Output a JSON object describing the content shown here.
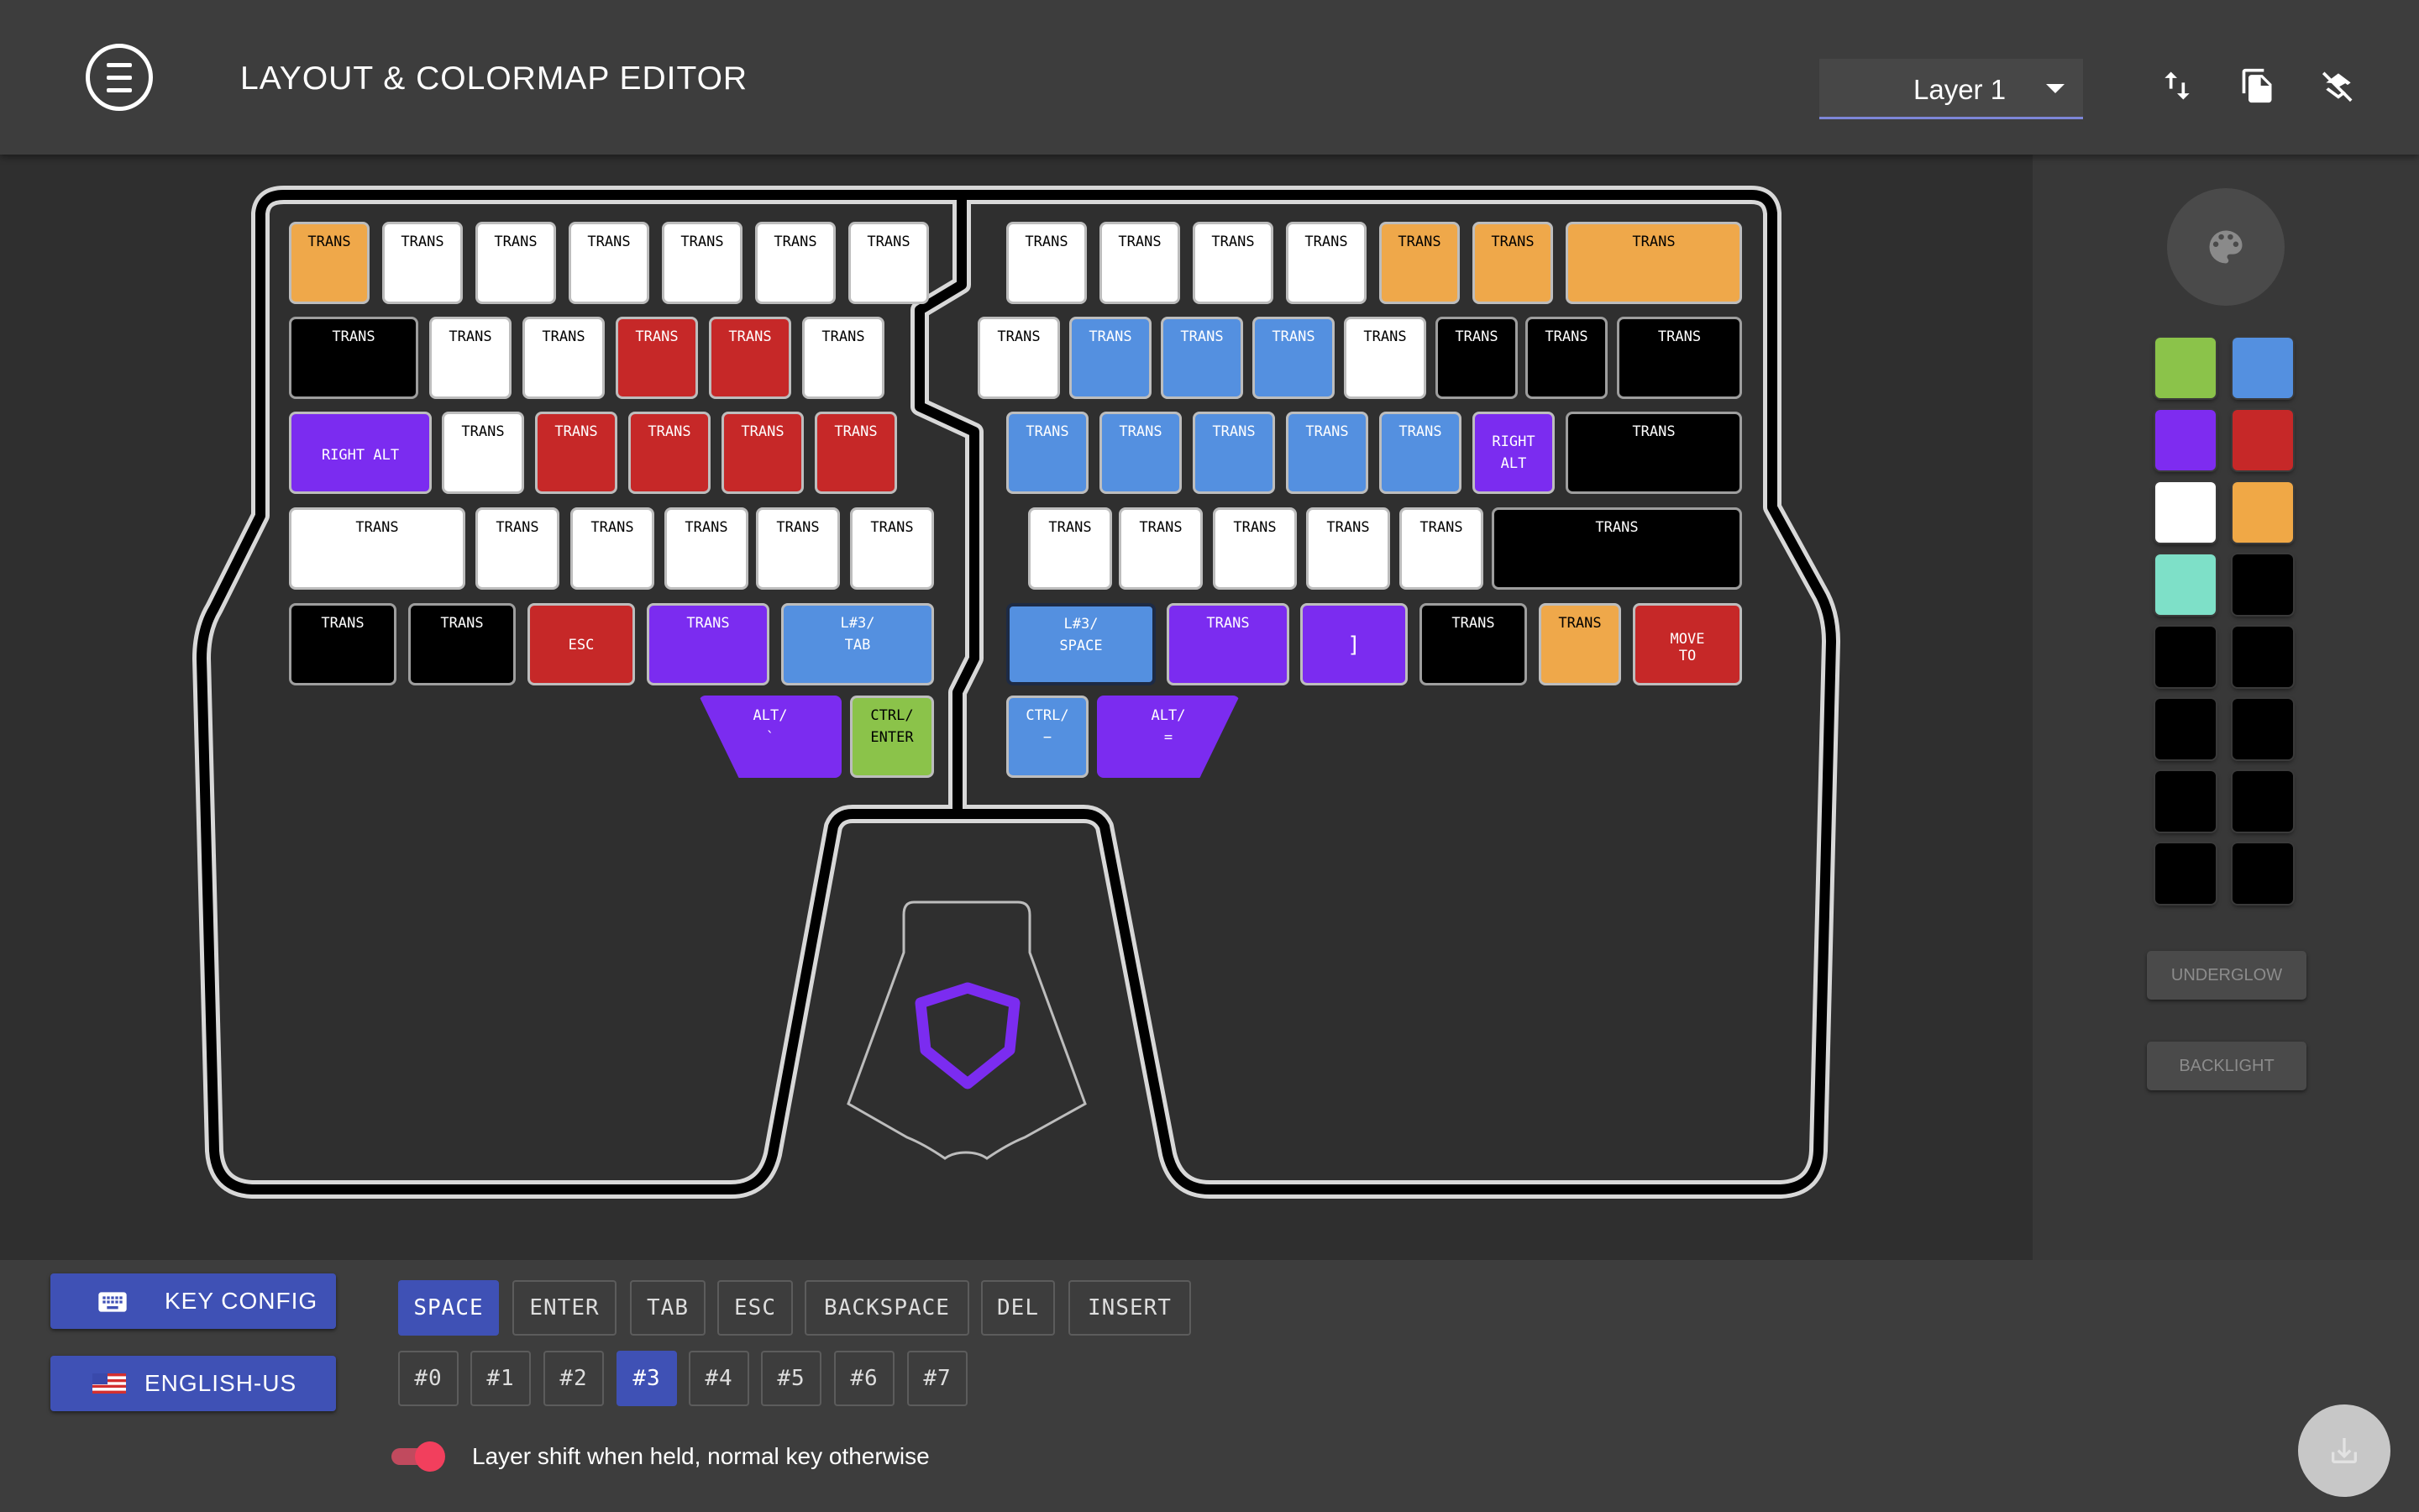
{
  "header": {
    "title": "LAYOUT & COLORMAP EDITOR",
    "layer_select": "Layer 1",
    "icons": [
      "swap-vertical-icon",
      "copy-icon",
      "layers-off-icon"
    ]
  },
  "palette": {
    "icon": "palette-icon",
    "swatches": [
      "#8bc34a",
      "#5490e0",
      "#7e2cf0",
      "#c62828",
      "#ffffff",
      "#f0a846",
      "#7ee0c8",
      "#000000",
      "#000000",
      "#000000",
      "#000000",
      "#000000",
      "#000000",
      "#000000",
      "#000000",
      "#000000"
    ],
    "underglow_label": "UNDERGLOW",
    "backlight_label": "BACKLIGHT"
  },
  "colors": {
    "white": "#ffffff",
    "black": "#000000",
    "orange": "#efa84a",
    "red": "#c62828",
    "purple": "#7b2cf0",
    "blue": "#5490e0",
    "green": "#8bc34a",
    "accent": "#3f51b5"
  },
  "keys": [
    {
      "t": "TRANS",
      "c": "orange"
    },
    {
      "t": "TRANS",
      "c": "white"
    },
    {
      "t": "TRANS",
      "c": "white"
    },
    {
      "t": "TRANS",
      "c": "white"
    },
    {
      "t": "TRANS",
      "c": "white"
    },
    {
      "t": "TRANS",
      "c": "white"
    },
    {
      "t": "TRANS",
      "c": "white"
    },
    {
      "t": "TRANS",
      "c": "white"
    },
    {
      "t": "TRANS",
      "c": "white"
    },
    {
      "t": "TRANS",
      "c": "white"
    },
    {
      "t": "TRANS",
      "c": "white"
    },
    {
      "t": "TRANS",
      "c": "orange"
    },
    {
      "t": "TRANS",
      "c": "orange"
    },
    {
      "t": "TRANS",
      "c": "orange"
    },
    {
      "t": "TRANS",
      "c": "black"
    },
    {
      "t": "TRANS",
      "c": "white"
    },
    {
      "t": "TRANS",
      "c": "white"
    },
    {
      "t": "TRANS",
      "c": "red"
    },
    {
      "t": "TRANS",
      "c": "red"
    },
    {
      "t": "TRANS",
      "c": "white"
    },
    {
      "t": "TRANS",
      "c": "white"
    },
    {
      "t": "TRANS",
      "c": "blue"
    },
    {
      "t": "TRANS",
      "c": "blue"
    },
    {
      "t": "TRANS",
      "c": "blue"
    },
    {
      "t": "TRANS",
      "c": "white"
    },
    {
      "t": "TRANS",
      "c": "black"
    },
    {
      "t": "TRANS",
      "c": "black"
    },
    {
      "t": "TRANS",
      "c": "black"
    },
    {
      "t": "RIGHT ALT",
      "c": "purple"
    },
    {
      "t": "TRANS",
      "c": "white"
    },
    {
      "t": "TRANS",
      "c": "red"
    },
    {
      "t": "TRANS",
      "c": "red"
    },
    {
      "t": "TRANS",
      "c": "red"
    },
    {
      "t": "TRANS",
      "c": "red"
    },
    {
      "t": "TRANS",
      "c": "blue"
    },
    {
      "t": "TRANS",
      "c": "blue"
    },
    {
      "t": "TRANS",
      "c": "blue"
    },
    {
      "t": "TRANS",
      "c": "blue"
    },
    {
      "t": "TRANS",
      "c": "blue"
    },
    {
      "t": "RIGHT\nALT",
      "c": "purple"
    },
    {
      "t": "TRANS",
      "c": "black"
    },
    {
      "t": "TRANS",
      "c": "white"
    },
    {
      "t": "TRANS",
      "c": "white"
    },
    {
      "t": "TRANS",
      "c": "white"
    },
    {
      "t": "TRANS",
      "c": "white"
    },
    {
      "t": "TRANS",
      "c": "white"
    },
    {
      "t": "TRANS",
      "c": "white"
    },
    {
      "t": "TRANS",
      "c": "white"
    },
    {
      "t": "TRANS",
      "c": "white"
    },
    {
      "t": "TRANS",
      "c": "white"
    },
    {
      "t": "TRANS",
      "c": "white"
    },
    {
      "t": "TRANS",
      "c": "white"
    },
    {
      "t": "TRANS",
      "c": "black"
    },
    {
      "t": "TRANS",
      "c": "black"
    },
    {
      "t": "TRANS",
      "c": "black"
    },
    {
      "t": "\nESC",
      "c": "red"
    },
    {
      "t": "TRANS",
      "c": "purple"
    },
    {
      "t": "L#3/\nTAB",
      "c": "blue"
    },
    {
      "t": "L#3/\nSPACE",
      "c": "blue",
      "sel": true
    },
    {
      "t": "TRANS",
      "c": "purple"
    },
    {
      "t": "\n]",
      "c": "purple"
    },
    {
      "t": "TRANS",
      "c": "black"
    },
    {
      "t": "TRANS",
      "c": "orange"
    },
    {
      "t": "\nMOVE\nTO",
      "c": "red"
    },
    {
      "t": "ALT/\n`",
      "c": "purple"
    },
    {
      "t": "CTRL/\nENTER",
      "c": "green"
    },
    {
      "t": "CTRL/\n−",
      "c": "blue"
    },
    {
      "t": "ALT/\n=",
      "c": "purple"
    }
  ],
  "bottom": {
    "key_config_label": "KEY CONFIG",
    "language_label": "ENGLISH-US",
    "key_chips": [
      "SPACE",
      "ENTER",
      "TAB",
      "ESC",
      "BACKSPACE",
      "DEL",
      "INSERT"
    ],
    "layer_chips": [
      "#0",
      "#1",
      "#2",
      "#3",
      "#4",
      "#5",
      "#6",
      "#7"
    ],
    "toggle_label": "Layer shift when held, normal key otherwise"
  }
}
